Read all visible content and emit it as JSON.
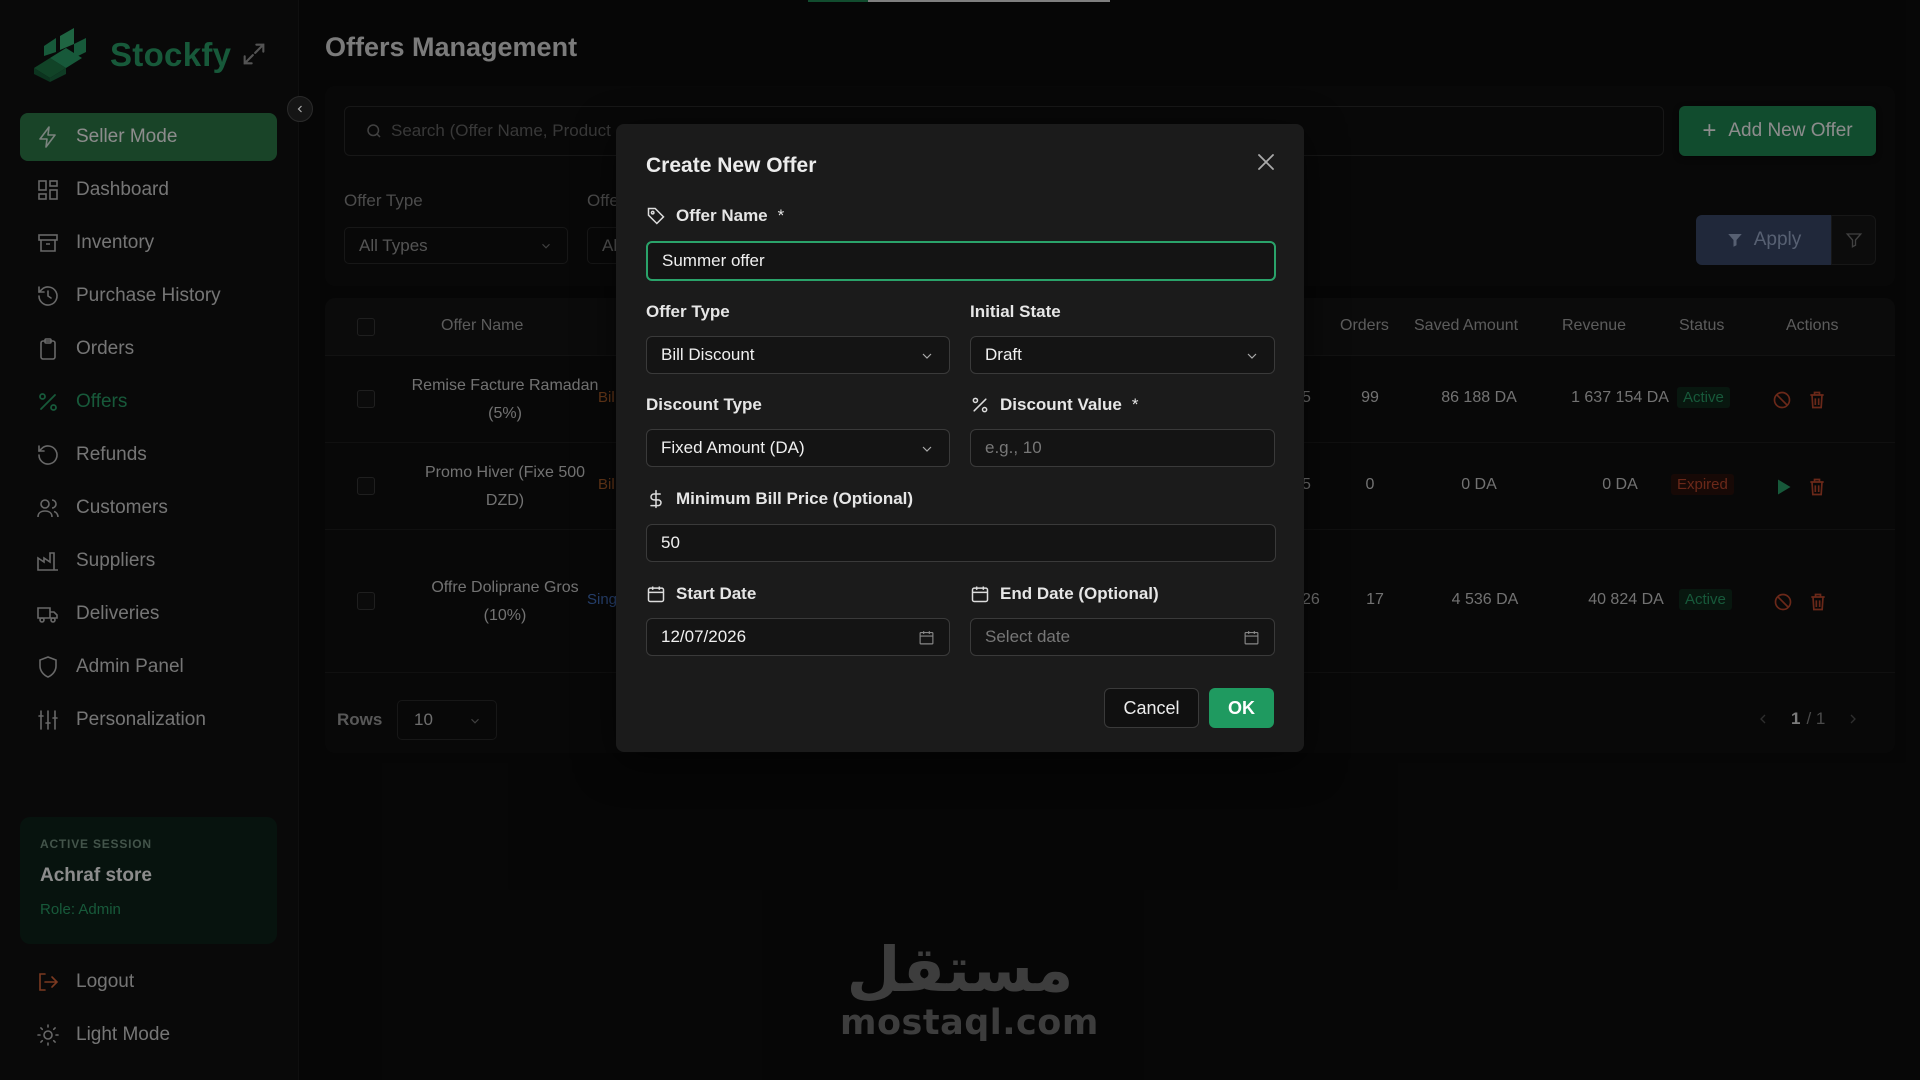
{
  "app": {
    "name": "Stockfy"
  },
  "sidebar": {
    "items": [
      {
        "label": "Seller Mode",
        "icon": "bolt-icon"
      },
      {
        "label": "Dashboard",
        "icon": "grid-icon"
      },
      {
        "label": "Inventory",
        "icon": "archive-icon"
      },
      {
        "label": "Purchase History",
        "icon": "history-icon"
      },
      {
        "label": "Orders",
        "icon": "clipboard-icon"
      },
      {
        "label": "Offers",
        "icon": "percent-icon"
      },
      {
        "label": "Refunds",
        "icon": "refund-icon"
      },
      {
        "label": "Customers",
        "icon": "users-icon"
      },
      {
        "label": "Suppliers",
        "icon": "factory-icon"
      },
      {
        "label": "Deliveries",
        "icon": "truck-icon"
      },
      {
        "label": "Admin Panel",
        "icon": "shield-icon"
      },
      {
        "label": "Personalization",
        "icon": "sliders-icon"
      }
    ],
    "session": {
      "caption": "ACTIVE SESSION",
      "store": "Achraf store",
      "role": "Role: Admin"
    },
    "bottom": [
      {
        "label": "Logout",
        "icon": "logout-icon"
      },
      {
        "label": "Light Mode",
        "icon": "sun-icon"
      }
    ]
  },
  "main": {
    "title": "Offers Management",
    "search_placeholder": "Search (Offer Name, Product",
    "add_button": "Add New Offer",
    "filters": {
      "offer_type_label": "Offer Type",
      "offer_type_value": "All Types",
      "second_label": "Offe",
      "second_value": "Al",
      "apply": "Apply"
    },
    "table": {
      "columns": {
        "offer_name": "Offer Name",
        "orders": "Orders",
        "saved": "Saved Amount",
        "revenue": "Revenue",
        "status": "Status",
        "actions": "Actions"
      },
      "rows": [
        {
          "name1": "Remise Facture Ramadan",
          "name2": "(5%)",
          "type": "Bil",
          "partial": "5",
          "orders": "99",
          "saved": "86 188 DA",
          "revenue": "1 637 154 DA",
          "status": "Active"
        },
        {
          "name1": "Promo Hiver (Fixe 500",
          "name2": "DZD)",
          "type": "Bil",
          "partial": "5",
          "orders": "0",
          "saved": "0 DA",
          "revenue": "0 DA",
          "status": "Expired"
        },
        {
          "name1": "Offre Doliprane Gros",
          "name2": "(10%)",
          "type": "Sing",
          "partial": "26",
          "orders": "17",
          "saved": "4 536 DA",
          "revenue": "40 824 DA",
          "status": "Active"
        }
      ]
    },
    "rows_label": "Rows",
    "rows_value": "10",
    "pager_current": "1",
    "pager_total": "/ 1"
  },
  "modal": {
    "title": "Create New Offer",
    "offer_name_label": "Offer Name",
    "offer_name_value": "Summer offer",
    "required_mark": "*",
    "offer_type_label": "Offer Type",
    "offer_type_value": "Bill Discount",
    "initial_state_label": "Initial State",
    "initial_state_value": "Draft",
    "discount_type_label": "Discount Type",
    "discount_type_value": "Fixed Amount (DA)",
    "discount_value_label": "Discount Value",
    "discount_value_placeholder": "e.g., 10",
    "min_bill_label": "Minimum Bill Price (Optional)",
    "min_bill_value": "50",
    "start_date_label": "Start Date",
    "start_date_value": "12/07/2026",
    "end_date_label": "End Date (Optional)",
    "end_date_placeholder": "Select date",
    "cancel": "Cancel",
    "ok": "OK"
  },
  "watermark": {
    "arabic": "مستقل",
    "latin": "mostaql.com"
  },
  "colors": {
    "accent": "#2aa36a",
    "seller_bg": "#2e7d4a",
    "expired": "#c24a2e",
    "apply_bg": "#3b4a6b"
  }
}
